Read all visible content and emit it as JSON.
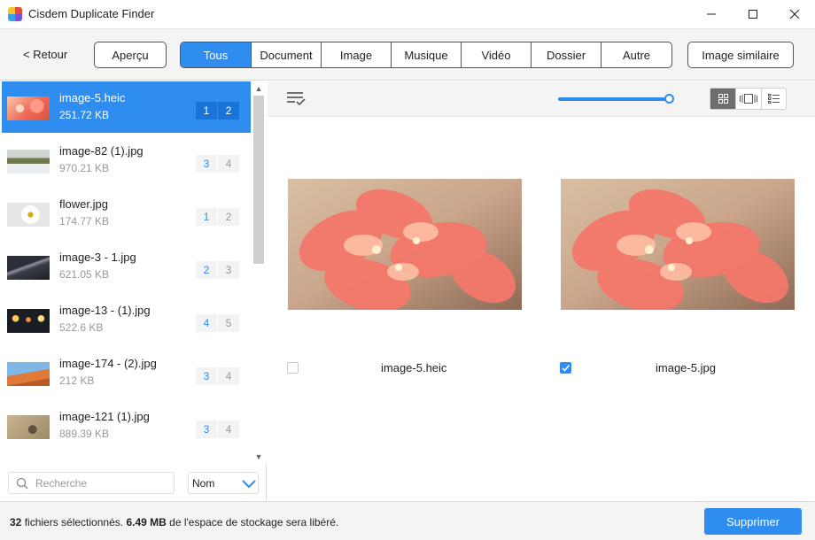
{
  "window": {
    "title": "Cisdem Duplicate Finder"
  },
  "toolbar": {
    "back_label": "< Retour",
    "preview_label": "Aperçu",
    "tabs": [
      {
        "label": "Tous",
        "active": true
      },
      {
        "label": "Document"
      },
      {
        "label": "Image"
      },
      {
        "label": "Musique"
      },
      {
        "label": "Vidéo"
      },
      {
        "label": "Dossier"
      },
      {
        "label": "Autre"
      }
    ],
    "similar_label": "Image similaire"
  },
  "file_list": [
    {
      "name": "image-5.heic",
      "size": "251.72 KB",
      "a": "1",
      "b": "2",
      "thumb": "flower-red",
      "selected": true
    },
    {
      "name": "image-82 (1).jpg",
      "size": "970.21 KB",
      "a": "3",
      "b": "4",
      "thumb": "field"
    },
    {
      "name": "flower.jpg",
      "size": "174.77 KB",
      "a": "1",
      "b": "2",
      "thumb": "daisy"
    },
    {
      "name": "image-3 - 1.jpg",
      "size": "621.05 KB",
      "a": "2",
      "b": "3",
      "thumb": "road-night"
    },
    {
      "name": "image-13 - (1).jpg",
      "size": "522.6 KB",
      "a": "4",
      "b": "5",
      "thumb": "bokeh"
    },
    {
      "name": "image-174 - (2).jpg",
      "size": "212 KB",
      "a": "3",
      "b": "4",
      "thumb": "desert"
    },
    {
      "name": "image-121 (1).jpg",
      "size": "889.39 KB",
      "a": "3",
      "b": "4",
      "thumb": "gravel"
    }
  ],
  "search": {
    "placeholder": "Recherche"
  },
  "sort": {
    "value": "Nom"
  },
  "preview": {
    "slider_level": 1.0,
    "items": [
      {
        "name": "image-5.heic",
        "checked": false
      },
      {
        "name": "image-5.jpg",
        "checked": true
      }
    ]
  },
  "status": {
    "count": "32",
    "count_text": "fichiers sélectionnés.",
    "size": "6.49 MB",
    "size_text": "de l'espace de stockage sera libéré."
  },
  "actions": {
    "delete_label": "Supprimer"
  },
  "colors": {
    "accent": "#2f8df0"
  }
}
